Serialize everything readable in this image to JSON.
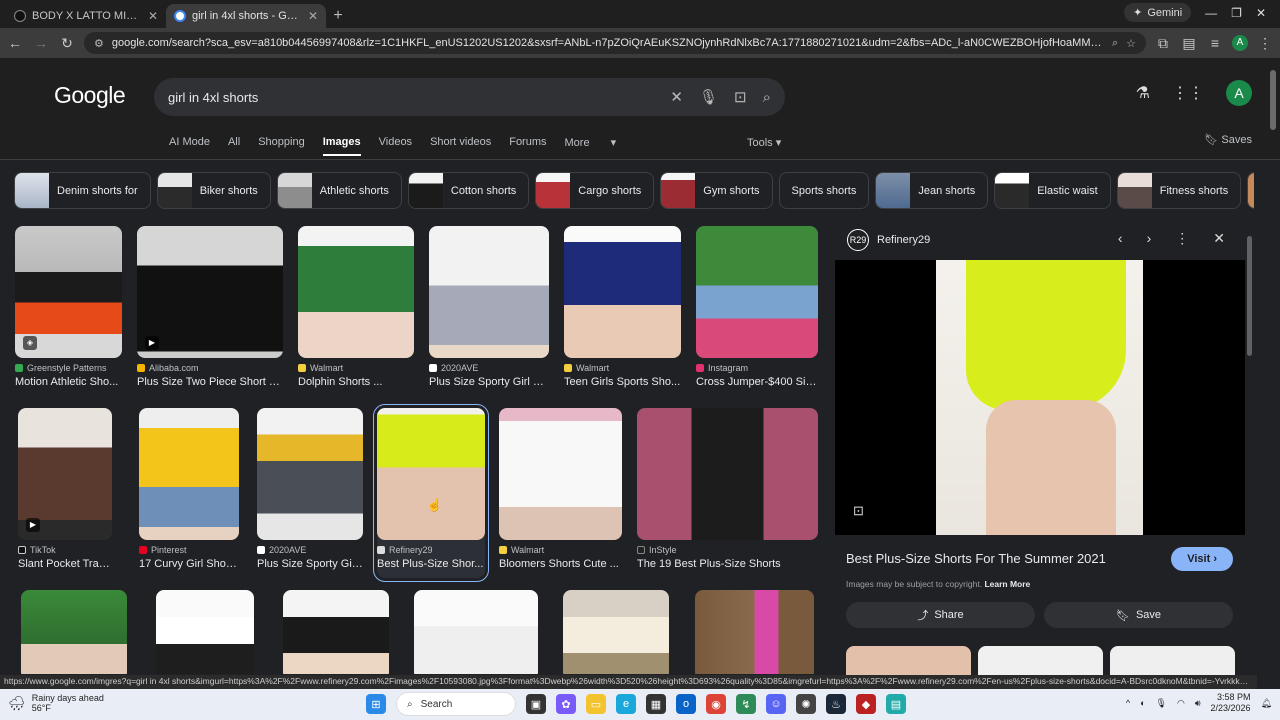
{
  "browser": {
    "tabs": [
      {
        "title": "BODY X LATTO MINI SHORTS (",
        "active": false
      },
      {
        "title": "girl in 4xl shorts - Google Searc",
        "active": true
      }
    ],
    "gemini_label": "Gemini",
    "url": "google.com/search?sca_esv=a810b04456997408&rlz=1C1HKFL_enUS1202US1202&sxsrf=ANbL-n7pZOiQrAEuKSZNOjynhRdNlxBc7A:1771880271021&udm=2&fbs=ADc_l-aN0CWEZBOHjofHoaMMDiKp9lEhFAN_4ain3HSNQWw-mMGV...",
    "profile_initial": "A"
  },
  "google": {
    "logo": "Google",
    "query": "girl in 4xl shorts",
    "nav_tabs": [
      "AI Mode",
      "All",
      "Shopping",
      "Images",
      "Videos",
      "Short videos",
      "Forums",
      "More"
    ],
    "selected_tab": "Images",
    "tools_label": "Tools",
    "saves_label": "Saves",
    "profile_initial": "A"
  },
  "chips": [
    {
      "label": "Denim shorts for",
      "color": "#a9b5c8"
    },
    {
      "label": "Biker shorts",
      "color": "#2b2b2b"
    },
    {
      "label": "Athletic shorts",
      "color": "#8d8d8d"
    },
    {
      "label": "Cotton shorts",
      "color": "#1b1b1b"
    },
    {
      "label": "Cargo shorts",
      "color": "#b8323a"
    },
    {
      "label": "Gym shorts",
      "color": "#9c2c34"
    },
    {
      "label": "Sports shorts",
      "color": ""
    },
    {
      "label": "Jean shorts",
      "color": "#4f6a90"
    },
    {
      "label": "Elastic waist",
      "color": "#2a2a2a"
    },
    {
      "label": "Fitness shorts",
      "color": "#5a4a48"
    }
  ],
  "results": {
    "row1": [
      {
        "source": "Greenstyle Patterns",
        "caption": "Motion Athletic Sho...",
        "icon": "#34a853"
      },
      {
        "source": "Alibaba.com",
        "caption": "Plus Size Two Piece Short S...",
        "icon": "#f4b400"
      },
      {
        "source": "Walmart",
        "caption": "Dolphin Shorts ...",
        "icon": "#f4d03f"
      },
      {
        "source": "2020AVE",
        "caption": "Plus Size Sporty Girl Bi...",
        "icon": "#ffffff"
      },
      {
        "source": "Walmart",
        "caption": "Teen Girls Sports Sho...",
        "icon": "#f4d03f"
      },
      {
        "source": "Instagram",
        "caption": "Cross Jumper-$400 Siz...",
        "icon": "#e1306c"
      }
    ],
    "row2": [
      {
        "source": "TikTok",
        "caption": "Slant Pocket Track ...",
        "icon": "#111111"
      },
      {
        "source": "Pinterest",
        "caption": "17 Curvy Girl Short ...",
        "icon": "#e60023"
      },
      {
        "source": "2020AVE",
        "caption": "Plus Size Sporty Gir...",
        "icon": "#ffffff"
      },
      {
        "source": "Refinery29",
        "caption": "Best Plus-Size Shor...",
        "icon": "#dddddd"
      },
      {
        "source": "Walmart",
        "caption": "Bloomers Shorts Cute ...",
        "icon": "#f4d03f"
      },
      {
        "source": "InStyle",
        "caption": "The 19 Best Plus-Size Shorts",
        "icon": "#222222"
      }
    ]
  },
  "panel": {
    "source": "Refinery29",
    "logo_text": "R29",
    "title": "Best Plus-Size Shorts For The Summer 2021",
    "visit_label": "Visit",
    "copyright": "Images may be subject to copyright.",
    "learn_more": "Learn More",
    "share_label": "Share",
    "save_label": "Save"
  },
  "status_url": "https://www.google.com/imgres?q=girl in 4xl shorts&imgurl=https%3A%2F%2Fwww.refinery29.com%2Fimages%2F10593080.jpg%3Fformat%3Dwebp%26width%3D520%26height%3D693%26quality%3D85&imgrefurl=https%3A%2F%2Fwww.refinery29.com%2Fen-us%2Fplus-size-shorts&docid=A-BDsrc0dknoM&tbnid=-YvrkkkCW5TbM&vet=12ahUK...",
  "taskbar": {
    "weather_line1": "Rainy days ahead",
    "weather_line2": "56°F",
    "search_placeholder": "Search",
    "time": "3:58 PM",
    "date": "2/23/2026"
  }
}
